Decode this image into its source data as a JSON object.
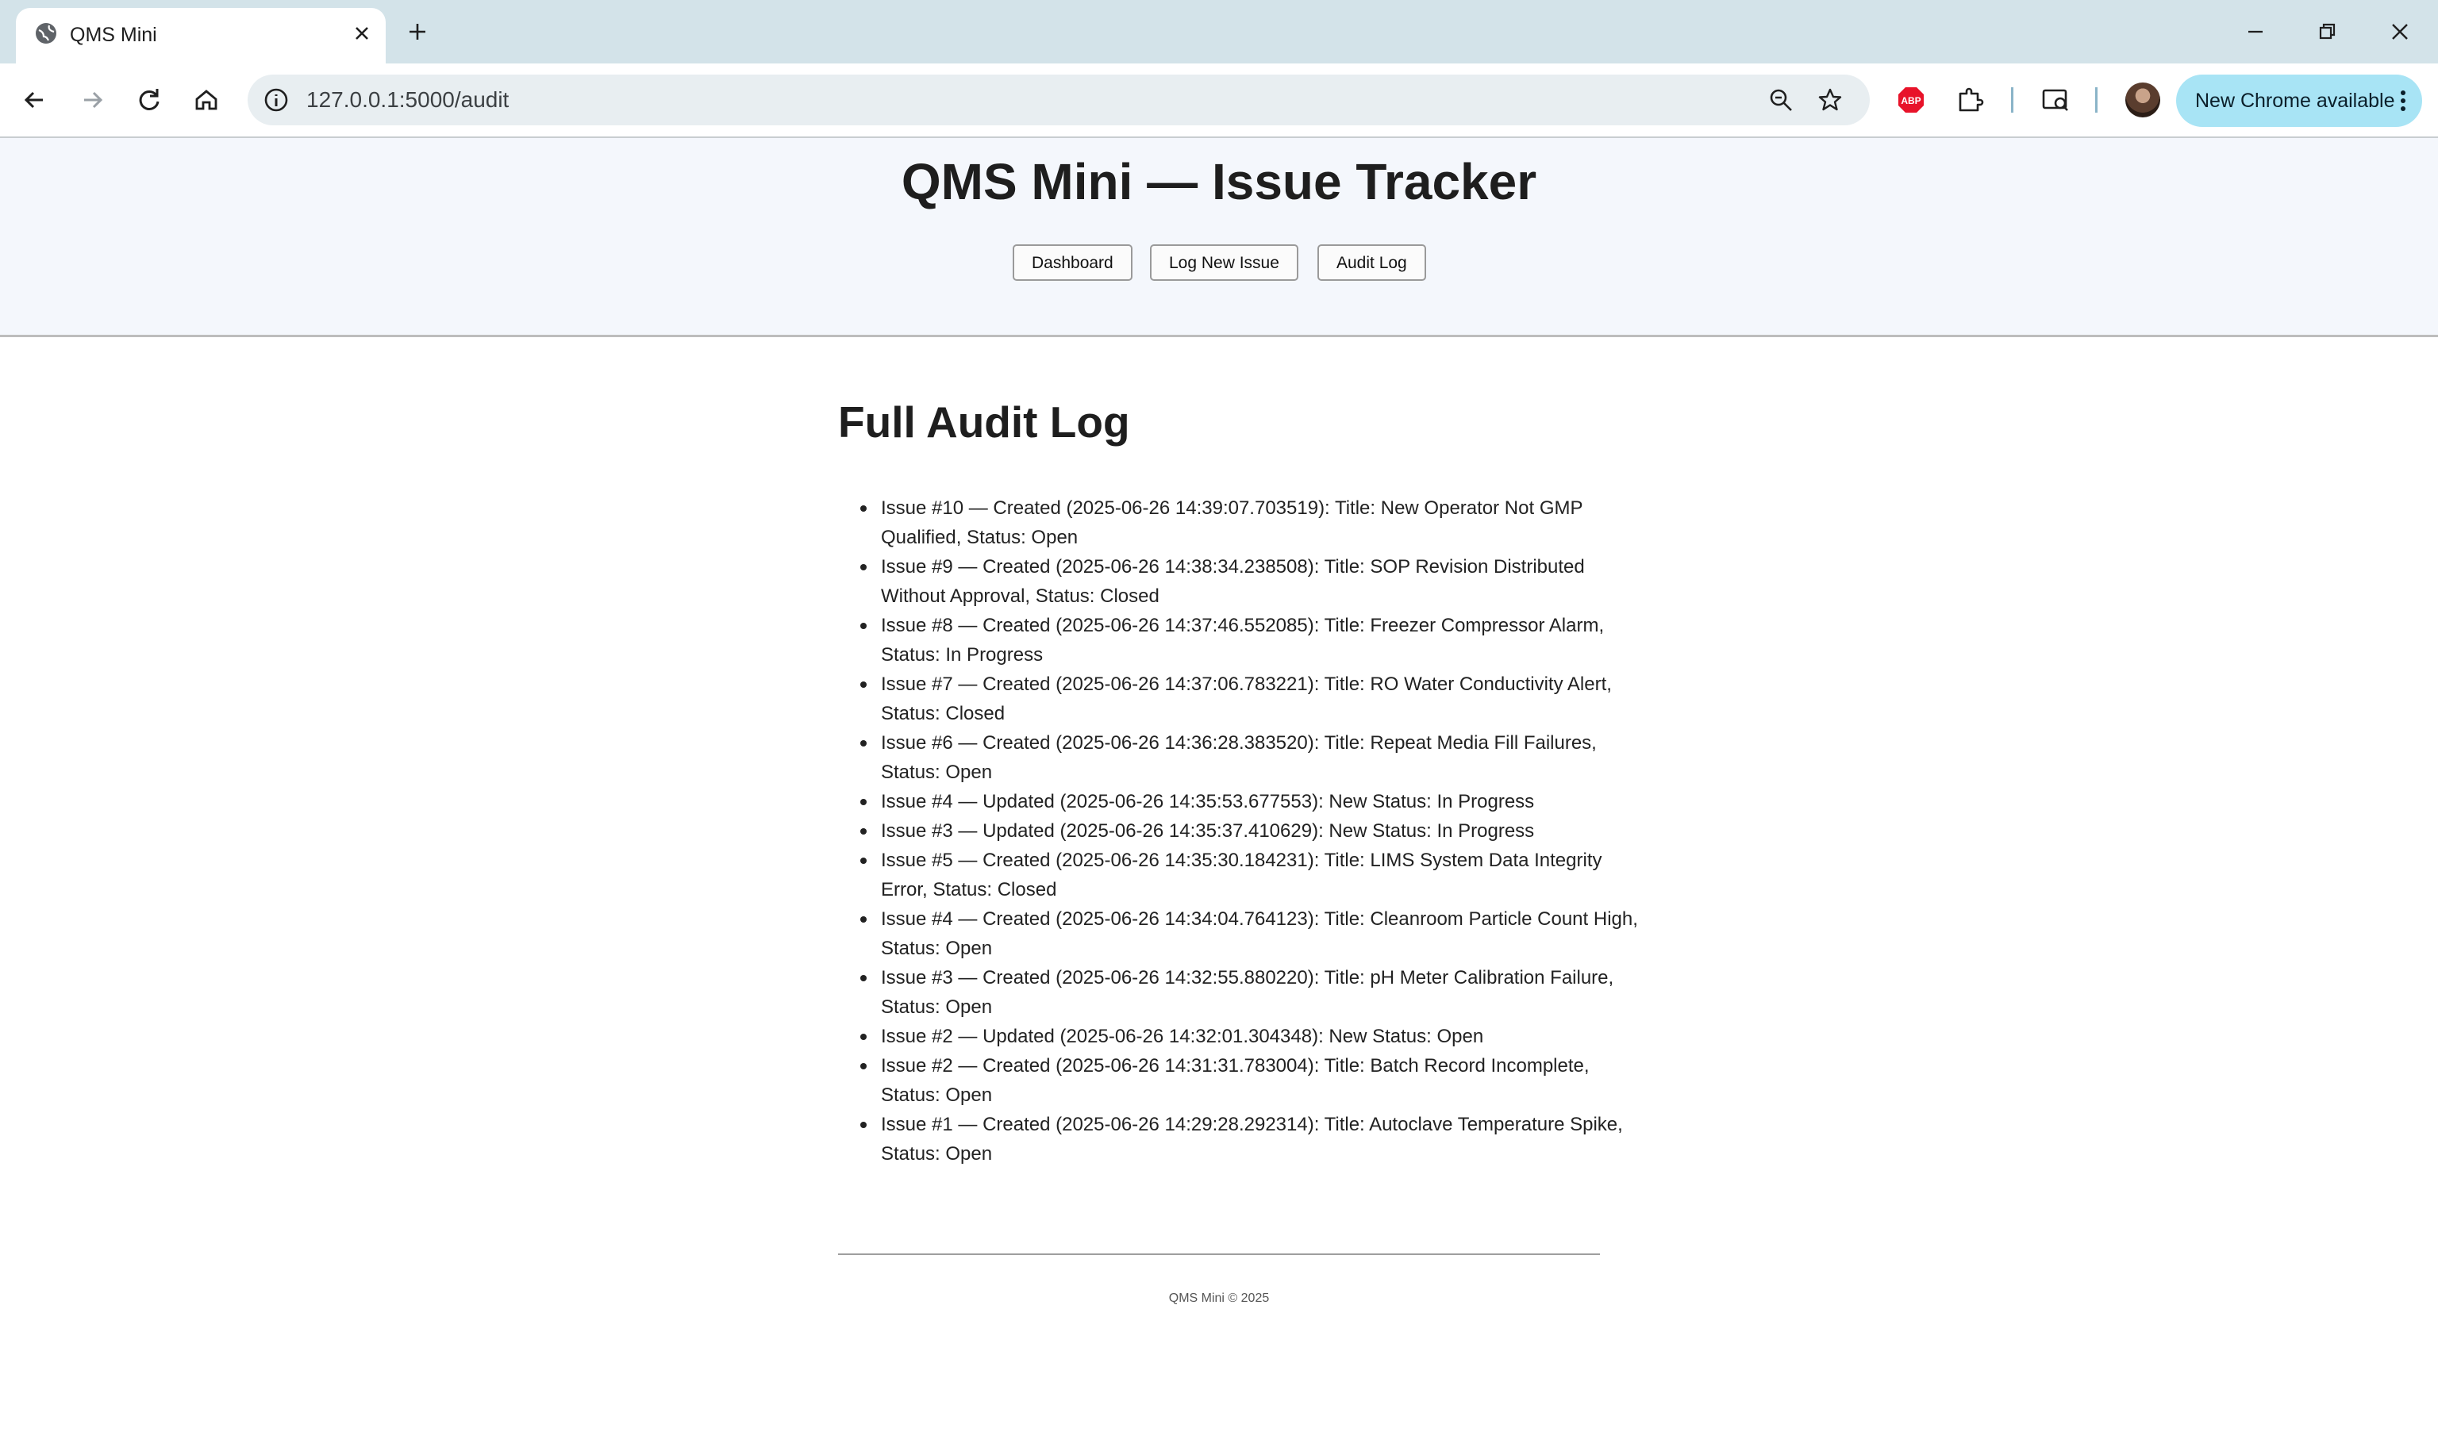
{
  "browser": {
    "tab_title": "QMS Mini",
    "url": "127.0.0.1:5000/audit",
    "update_button": "New Chrome available"
  },
  "site": {
    "title": "QMS Mini — Issue Tracker",
    "nav": [
      "Dashboard",
      "Log New Issue",
      "Audit Log"
    ]
  },
  "page": {
    "heading": "Full Audit Log",
    "entries": [
      "Issue #10 — Created (2025-06-26 14:39:07.703519): Title: New Operator Not GMP Qualified, Status: Open",
      "Issue #9 — Created (2025-06-26 14:38:34.238508): Title: SOP Revision Distributed Without Approval, Status: Closed",
      "Issue #8 — Created (2025-06-26 14:37:46.552085): Title: Freezer Compressor Alarm, Status: In Progress",
      "Issue #7 — Created (2025-06-26 14:37:06.783221): Title: RO Water Conductivity Alert, Status: Closed",
      "Issue #6 — Created (2025-06-26 14:36:28.383520): Title: Repeat Media Fill Failures, Status: Open",
      "Issue #4 — Updated (2025-06-26 14:35:53.677553): New Status: In Progress",
      "Issue #3 — Updated (2025-06-26 14:35:37.410629): New Status: In Progress",
      "Issue #5 — Created (2025-06-26 14:35:30.184231): Title: LIMS System Data Integrity Error, Status: Closed",
      "Issue #4 — Created (2025-06-26 14:34:04.764123): Title: Cleanroom Particle Count High, Status: Open",
      "Issue #3 — Created (2025-06-26 14:32:55.880220): Title: pH Meter Calibration Failure, Status: Open",
      "Issue #2 — Updated (2025-06-26 14:32:01.304348): New Status: Open",
      "Issue #2 — Created (2025-06-26 14:31:31.783004): Title: Batch Record Incomplete, Status: Open",
      "Issue #1 — Created (2025-06-26 14:29:28.292314): Title: Autoclave Temperature Spike, Status: Open"
    ]
  },
  "footer": {
    "text": "QMS Mini © 2025"
  }
}
